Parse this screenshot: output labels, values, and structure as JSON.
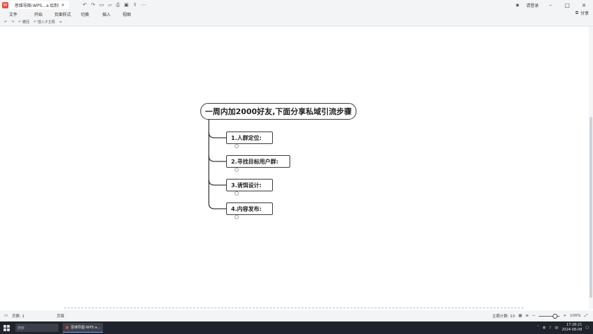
{
  "window": {
    "doc_tab_title": "思维导图-WPS...a 绘制",
    "sign_in_label": "请登录"
  },
  "menu": {
    "items": [
      "文件",
      "开始",
      "页面样式",
      "切换",
      "插入",
      "视图"
    ],
    "share_label": "分享"
  },
  "toolbar": {
    "items": [
      "↶",
      "↷",
      "↶ 撤回",
      "↶ 插入子主题",
      "+"
    ]
  },
  "mindmap": {
    "root": "一周内加2000好友,下面分享私域引流步骤",
    "branches": [
      "1.人群定位:",
      "2.寻找目标用户群:",
      "3.诱饵设计:",
      "4.内容发布:"
    ]
  },
  "statusbar": {
    "page_label": "页数: 1",
    "page_type": "页面",
    "topic_count_label": "主题计数: 10",
    "zoom_label": "100%"
  },
  "taskbar": {
    "search_placeholder": "搜索",
    "app_label": "思维导图-WPS a...",
    "time": "17:28:21",
    "date": "2024-08-08",
    "ime_label": "中"
  },
  "colors": {
    "node_border": "#3a3a3a",
    "taskbar_bg": "#1f232b",
    "chrome_bg": "#f3f4f6"
  }
}
